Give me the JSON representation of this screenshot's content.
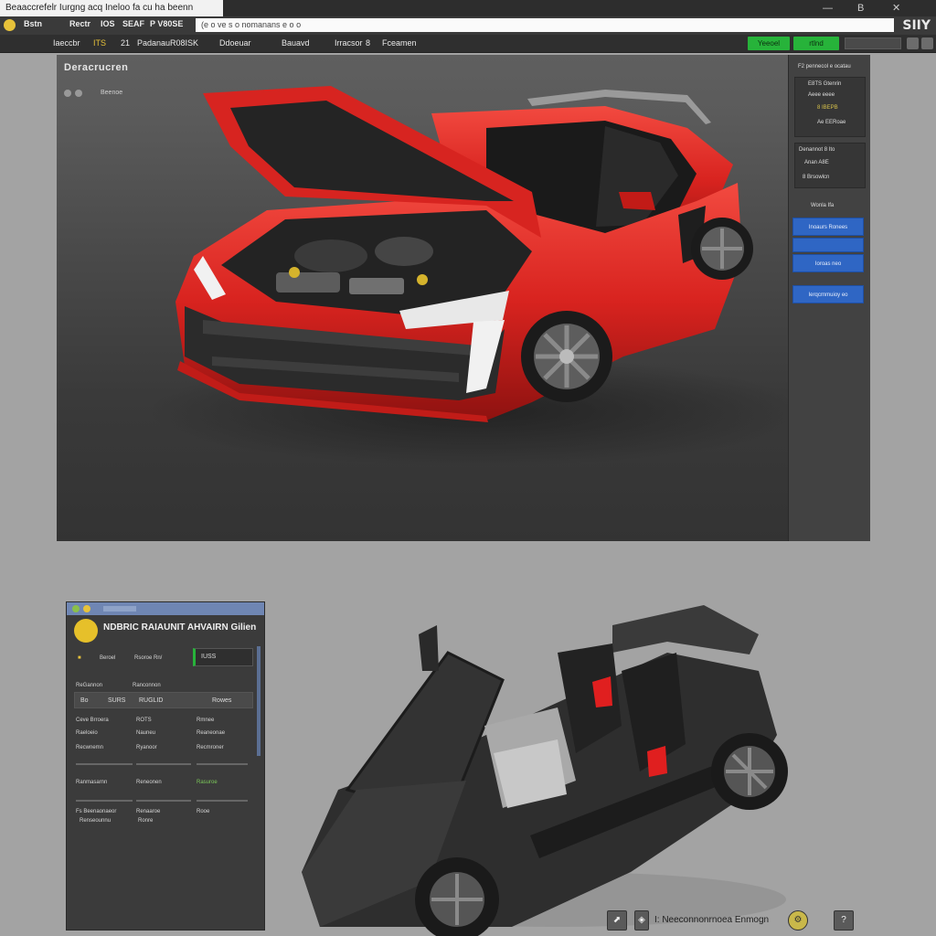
{
  "window": {
    "tab_title": "Beaaccrefelr  Iurgng acq Ineloo fa cu ha beenn",
    "address": "(e o ve s o nomanans e o o",
    "logo": "SIIY",
    "controls": [
      "—",
      "B",
      "✕"
    ]
  },
  "address_menu": [
    "Bstn",
    "Rectr",
    "IOS",
    "SEAF",
    "P V80SE"
  ],
  "menu": {
    "items": [
      "Iaeccbr",
      "ITS",
      "21",
      "Padanau",
      "R08ISK",
      "Ddoeuar",
      "Bauavd",
      "Irracsor",
      "8",
      "Fceamen"
    ],
    "green_buttons": [
      "Yeeoel",
      "rtlnd"
    ]
  },
  "viewport": {
    "title": "Deracrucren",
    "subtitle": "Beenoe"
  },
  "inspector": {
    "header": "F2 pennecol e ocatau",
    "group1": [
      "E8TS  Gtenrin",
      "Aeee  eeee",
      "8 IBEPB",
      "Ae EERoae"
    ],
    "group2": [
      "Denannot  8  Ito",
      "Anan A8E",
      "8 Brsowlcn"
    ],
    "group3_label": "Wonla Ifa",
    "buttons": [
      "Inoaurs  Ronees",
      "",
      "Ioroas  neo",
      "Ierqcrnmuioy eo"
    ]
  },
  "panel": {
    "title": "NDBRIC RAIAUNIT AHVAIRN Gilien",
    "field1_label": "Beroel",
    "field1_value": "Rsoroe Rn/",
    "field2_value": "IUSS",
    "section_labels": [
      "ReGannon",
      "Ranconnon"
    ],
    "tab_fields": [
      "Bo",
      "SURS",
      "RUGLID",
      "Rowes"
    ],
    "rows": [
      [
        "Ceve  Brroera",
        "ROTS",
        "Rmnee"
      ],
      [
        "Raeloeio",
        "Nauneu",
        "Reaneonae"
      ],
      [
        "Recwnemn",
        "Ryanoor",
        "Recmroner"
      ],
      [
        "Ranmasarnn",
        "Reneonen",
        "Rasuroe"
      ],
      [
        "Fs  Beenaonaeor",
        "Renaaroe",
        "Rooe"
      ],
      [
        "Renseounnu",
        "Ronre",
        ""
      ]
    ]
  },
  "status": {
    "text": "I:  Neeconnonrnoea Enmogn",
    "icons": [
      "⬈",
      "◈",
      "⚙"
    ]
  }
}
